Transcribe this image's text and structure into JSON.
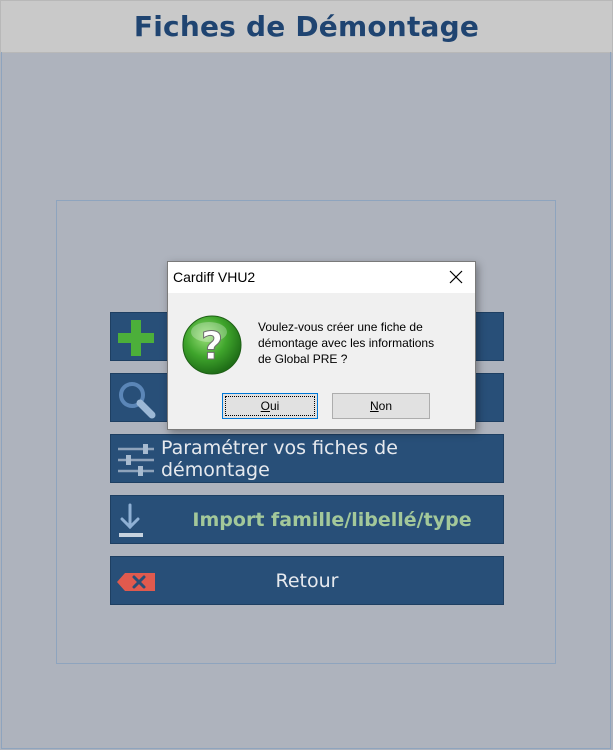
{
  "window": {
    "title": "Fiches de Démontage"
  },
  "menu": {
    "items": [
      {
        "id": "create",
        "label": "",
        "icon": "plus-icon"
      },
      {
        "id": "search",
        "label": "",
        "icon": "magnifier-icon"
      },
      {
        "id": "settings",
        "label": "Paramétrer vos fiches de démontage",
        "icon": "sliders-icon"
      },
      {
        "id": "import",
        "label": "Import famille/libellé/type",
        "icon": "download-icon"
      },
      {
        "id": "back",
        "label": "Retour",
        "icon": "backspace-icon"
      }
    ]
  },
  "dialog": {
    "caption": "Cardiff VHU2",
    "message_lines": [
      "Voulez-vous créer une fiche de",
      "démontage avec les informations",
      "de Global PRE ?"
    ],
    "buttons": {
      "yes": {
        "accel": "O",
        "rest": "ui"
      },
      "no": {
        "accel": "N",
        "rest": "on"
      }
    },
    "icon": "question-icon"
  },
  "colors": {
    "button_bg": "#284f78",
    "title_text": "#1f4471",
    "import_text": "#a3c89a",
    "plus_green": "#4caf3a",
    "back_red": "#e05a4e"
  }
}
